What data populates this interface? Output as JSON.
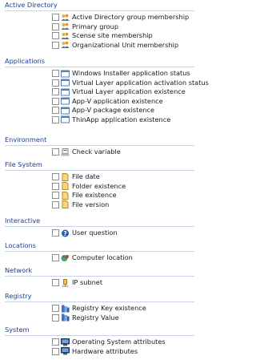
{
  "groups": [
    {
      "title": "Active Directory",
      "items": [
        {
          "label": "Active Directory group membership",
          "icon": "users-icon"
        },
        {
          "label": "Primary group",
          "icon": "users-icon"
        },
        {
          "label": "Scense site membership",
          "icon": "users-icon"
        },
        {
          "label": "Organizational Unit membership",
          "icon": "users-icon"
        }
      ]
    },
    {
      "title": "Applications",
      "items": [
        {
          "label": "Windows Installer application status",
          "icon": "window-icon"
        },
        {
          "label": "Virtual Layer application activation status",
          "icon": "window-icon"
        },
        {
          "label": "Virtual Layer application existence",
          "icon": "window-icon"
        },
        {
          "label": "App-V application existence",
          "icon": "window-icon"
        },
        {
          "label": "App-V package existence",
          "icon": "window-icon"
        },
        {
          "label": "ThinApp application existence",
          "icon": "window-icon"
        }
      ]
    },
    {
      "title": "Environment",
      "items": [
        {
          "label": "Check variable",
          "icon": "variable-icon"
        }
      ]
    },
    {
      "title": "File System",
      "items": [
        {
          "label": "File date",
          "icon": "file-icon"
        },
        {
          "label": "Folder existence",
          "icon": "file-icon"
        },
        {
          "label": "File existence",
          "icon": "file-icon"
        },
        {
          "label": "File version",
          "icon": "file-icon"
        }
      ]
    },
    {
      "title": "Interactive",
      "items": [
        {
          "label": "User question",
          "icon": "help-icon"
        }
      ]
    },
    {
      "title": "Locations",
      "items": [
        {
          "label": "Computer location",
          "icon": "location-icon"
        }
      ]
    },
    {
      "title": "Network",
      "items": [
        {
          "label": "IP subnet",
          "icon": "network-icon"
        }
      ]
    },
    {
      "title": "Registry",
      "items": [
        {
          "label": "Registry Key existence",
          "icon": "registry-icon"
        },
        {
          "label": "Registry Value",
          "icon": "registry-icon"
        }
      ]
    },
    {
      "title": "System",
      "items": [
        {
          "label": "Operating System attributes",
          "icon": "computer-icon"
        },
        {
          "label": "Hardware attributes",
          "icon": "computer-icon"
        }
      ]
    }
  ]
}
